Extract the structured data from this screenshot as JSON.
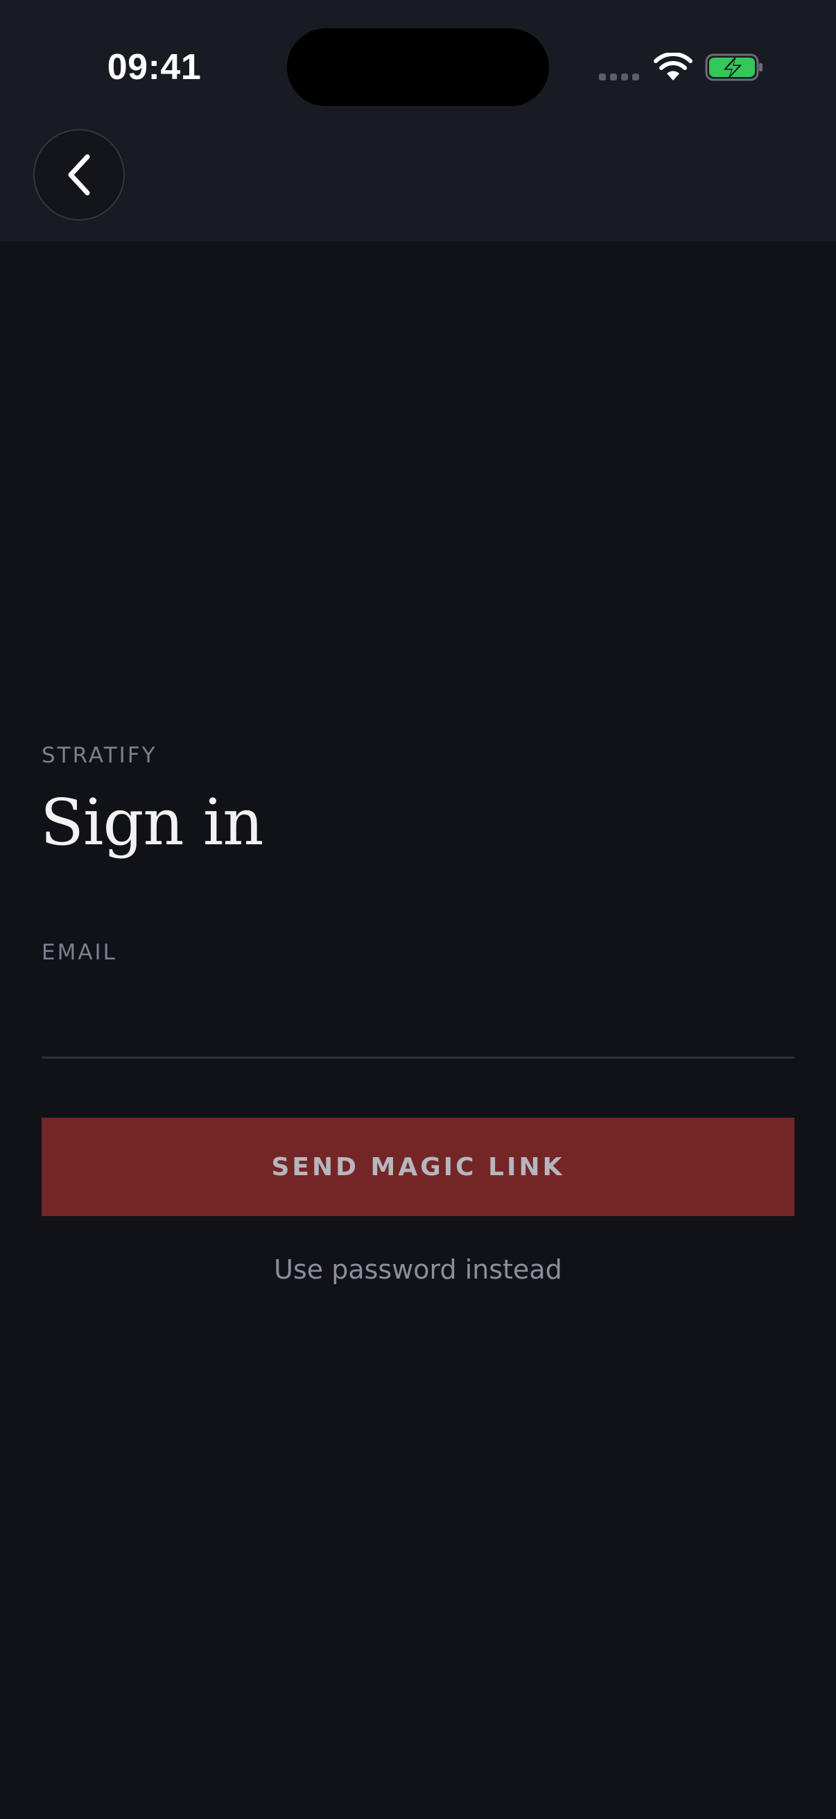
{
  "status_bar": {
    "time": "09:41",
    "icons": [
      "signal-icon",
      "wifi-icon",
      "battery-charging-icon"
    ],
    "battery_color": "#34c759"
  },
  "nav": {
    "back_icon": "chevron-left-icon"
  },
  "content": {
    "brand": "STRATIFY",
    "title": "Sign in",
    "email_label": "EMAIL",
    "email_value": "",
    "email_placeholder": "",
    "primary_button_label": "SEND MAGIC LINK",
    "secondary_link_label": "Use password instead"
  },
  "colors": {
    "background": "#111217",
    "header_background": "#181b22",
    "primary_button": "#742626",
    "muted_text": "#7a8090"
  }
}
